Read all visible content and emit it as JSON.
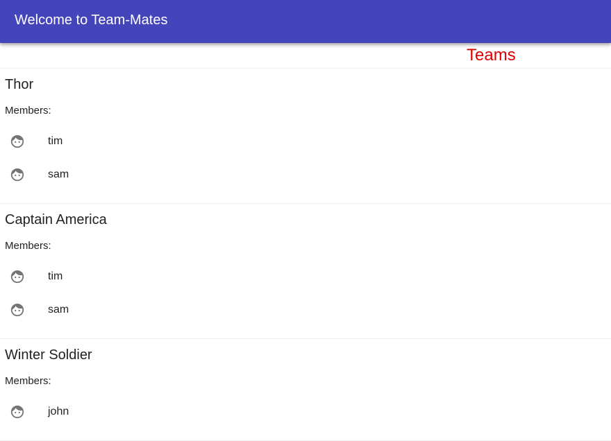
{
  "toolbar": {
    "title": "Welcome to Team-Mates"
  },
  "section": {
    "title": "Teams"
  },
  "members_label": "Members:",
  "icons": {
    "member": "face-icon"
  },
  "colors": {
    "toolbar": "#4444bb",
    "section_title": "#dd0000"
  },
  "teams": [
    {
      "name": "Thor",
      "members": [
        {
          "name": "tim"
        },
        {
          "name": "sam"
        }
      ]
    },
    {
      "name": "Captain America",
      "members": [
        {
          "name": "tim"
        },
        {
          "name": "sam"
        }
      ]
    },
    {
      "name": "Winter Soldier",
      "members": [
        {
          "name": "john"
        }
      ]
    }
  ]
}
